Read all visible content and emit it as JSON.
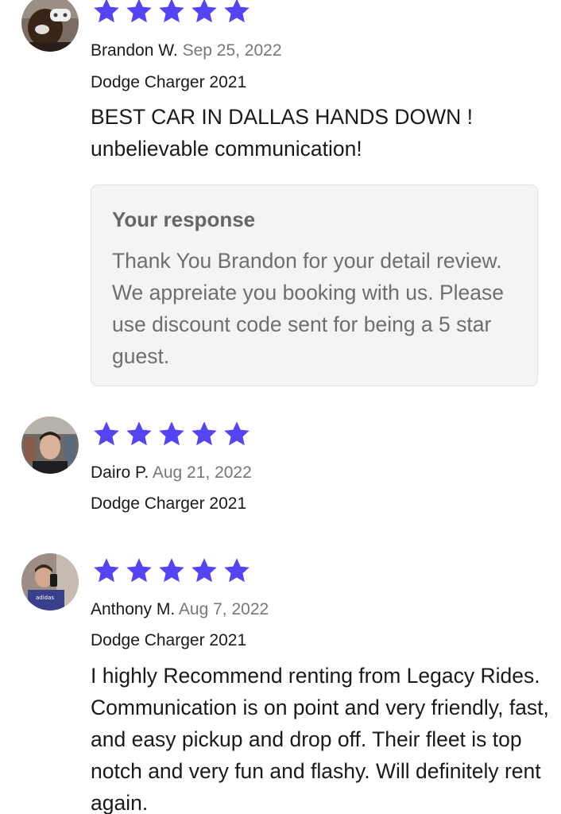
{
  "colors": {
    "star": "#5544f5",
    "date": "#777777",
    "response_bg": "#f4f4f4",
    "response_text": "#6e6e6e"
  },
  "reviews": [
    {
      "author": "Brandon W.",
      "date": "Sep 25, 2022",
      "vehicle": "Dodge Charger 2021",
      "rating": 5,
      "text": "BEST CAR IN DALLAS HANDS DOWN ! unbelievable communication!",
      "response": {
        "title": "Your response",
        "text": "Thank You Brandon for your detail review. We appreiate you booking with us. Please use discount code sent for being a 5 star guest."
      }
    },
    {
      "author": "Dairo P.",
      "date": "Aug 21, 2022",
      "vehicle": "Dodge Charger 2021",
      "rating": 5
    },
    {
      "author": "Anthony M.",
      "date": "Aug 7, 2022",
      "vehicle": "Dodge Charger 2021",
      "rating": 5,
      "text": "I highly Recommend renting from Legacy Rides. Communication is on point and very friendly, fast, and easy pickup and drop off. Their fleet is top notch and very fun and flashy. Will definitely rent again."
    }
  ]
}
